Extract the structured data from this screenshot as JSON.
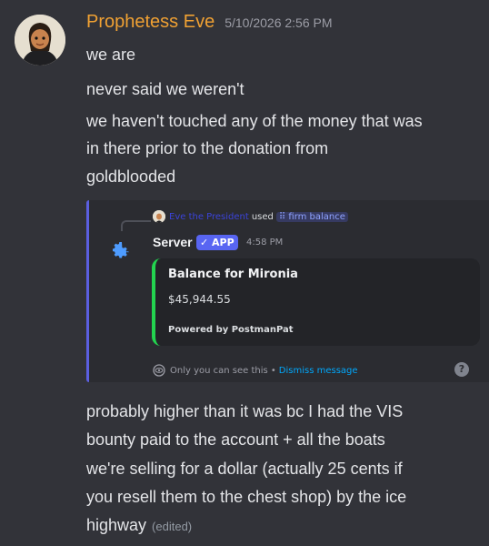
{
  "message": {
    "author": "Prophetess Eve",
    "timestamp": "5/10/2026 2:56 PM",
    "lines_before": [
      "we are",
      "never said we weren't",
      "we haven't touched any of the money that was",
      "in there prior to the donation from",
      "goldblooded"
    ],
    "lines_after": [
      "probably higher than it was bc I had the VIS",
      "bounty paid to the account + all the boats",
      "we're selling for a dollar (actually 25 cents if",
      "you resell them to the chest shop) by the ice",
      "highway"
    ],
    "edited_label": "(edited)"
  },
  "embed": {
    "reply": {
      "user": "Eve the President",
      "used_text": "used",
      "command": "firm balance"
    },
    "bot_name": "Server",
    "app_tag": "✓ APP",
    "time": "4:58 PM",
    "card": {
      "title": "Balance for Mironia",
      "amount": "$45,944.55",
      "footer": "Powered by PostmanPat"
    },
    "ephemeral_note": "Only you can see this •",
    "dismiss_label": "Dismiss message",
    "help_label": "?"
  },
  "colors": {
    "background": "#323339",
    "username": "#f0a133",
    "accent": "#5865f2",
    "card_border": "#23d44f",
    "link": "#00a8fc"
  }
}
